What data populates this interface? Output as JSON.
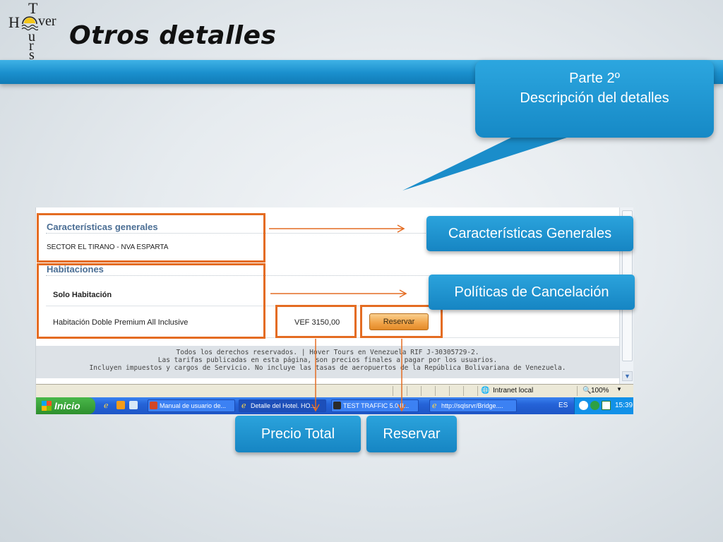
{
  "logo": {
    "t": "T",
    "h": "H",
    "ver": "ver",
    "u": "u",
    "r": "r",
    "s": "s"
  },
  "slide": {
    "title": "Otros detalles"
  },
  "callout": {
    "line1": "Parte 2º",
    "line2": "Descripción del detalles"
  },
  "page": {
    "general_heading": "Características generales",
    "address": "SECTOR EL TIRANO - NVA ESPARTA",
    "rooms_heading": "Habitaciones",
    "room_type": "Solo Habitación",
    "room_name": "Habitación Doble Premium All Inclusive",
    "price": "VEF  3150,00",
    "reserve_button": "Reservar",
    "footer_line1": "Todos los derechos reservados. | Hover Tours en Venezuela RIF J-30305729-2.",
    "footer_line2": "Las tarifas publicadas en esta página, son precios finales a pagar por los usuarios.",
    "footer_line3": "Incluyen impuestos y cargos de Servicio. No incluye las tasas de aeropuertos de la República Bolivariana de Venezuela."
  },
  "statusbar": {
    "zone": "Intranet local",
    "zoom": "100%"
  },
  "taskbar": {
    "start": "Inicio",
    "items": [
      "Manual de usuario de...",
      "Detalle del Hotel. HO...",
      "TEST  TRAFFIC 5.0 [I...",
      "http://sqlsrvr/Bridge...."
    ],
    "lang": "ES",
    "clock": "15:39"
  },
  "labels": {
    "caracteristicas": "Características Generales",
    "politicas": "Políticas de Cancelación",
    "precio_total": "Precio Total",
    "reservar": "Reservar"
  },
  "colors": {
    "accent_blue": "#1a8fcd",
    "highlight_orange": "#e46c22"
  }
}
